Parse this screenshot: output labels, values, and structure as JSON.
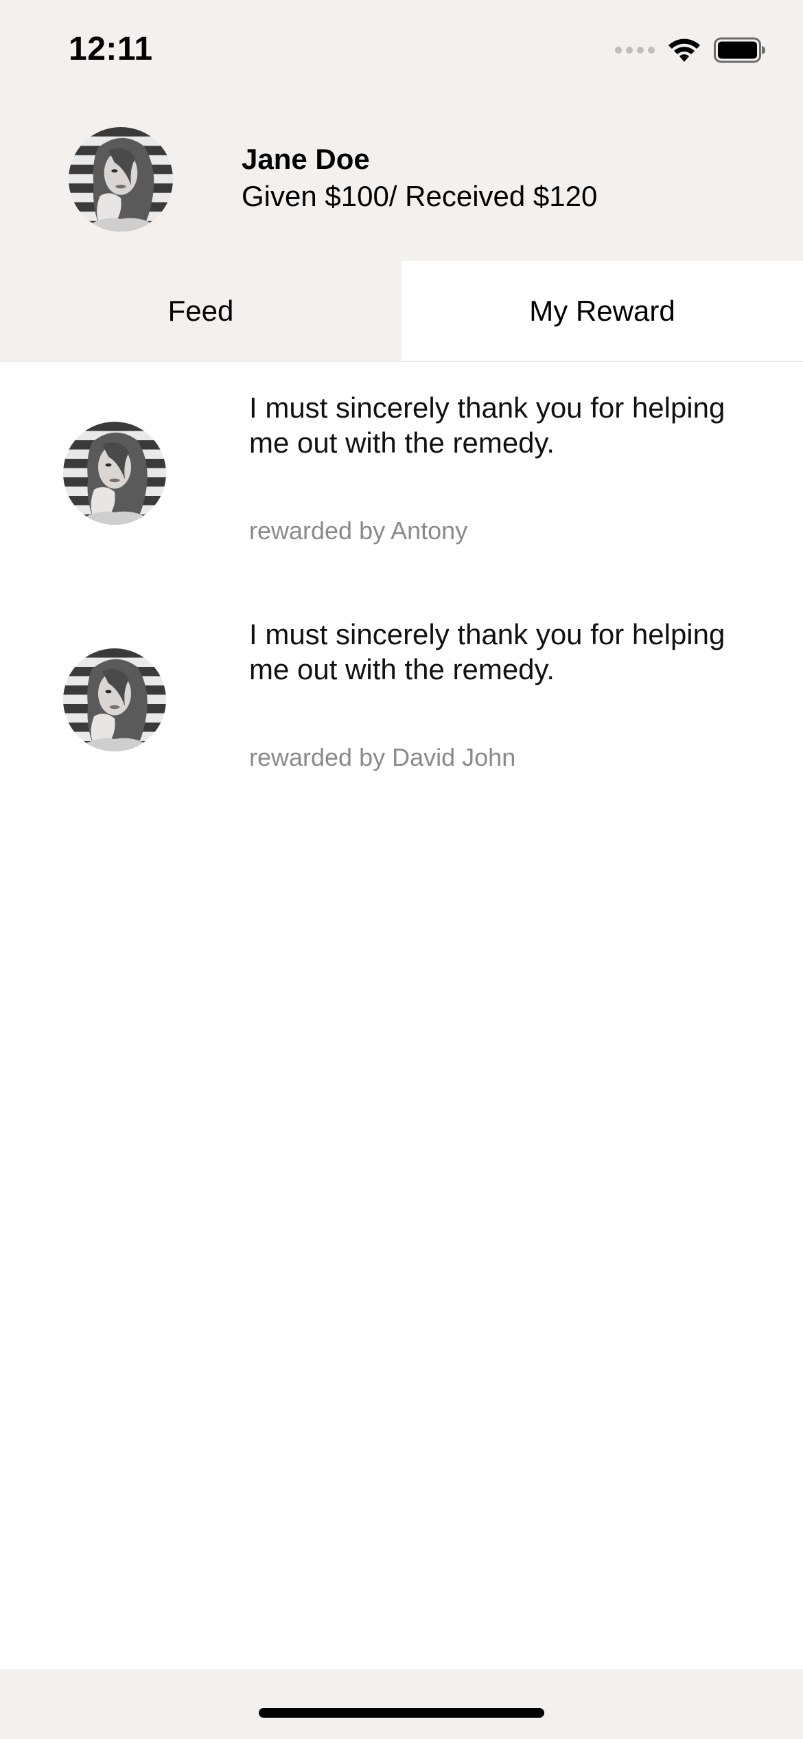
{
  "status_bar": {
    "time": "12:11"
  },
  "profile": {
    "name": "Jane Doe",
    "stats": "Given $100/ Received $120"
  },
  "tabs": [
    {
      "label": "Feed",
      "selected": false
    },
    {
      "label": "My Reward",
      "selected": true
    }
  ],
  "rewards": [
    {
      "message": "I must sincerely thank you for helping me out with the remedy.",
      "by": "rewarded by Antony"
    },
    {
      "message": "I must sincerely thank you for helping me out with the remedy.",
      "by": "rewarded by David John"
    }
  ],
  "icons": {
    "signal": "cellular-signal-icon",
    "wifi": "wifi-icon",
    "battery": "battery-icon",
    "avatar": "avatar"
  },
  "colors": {
    "header_bg": "#f3f0ee",
    "secondary_text": "#8a8a8a"
  }
}
